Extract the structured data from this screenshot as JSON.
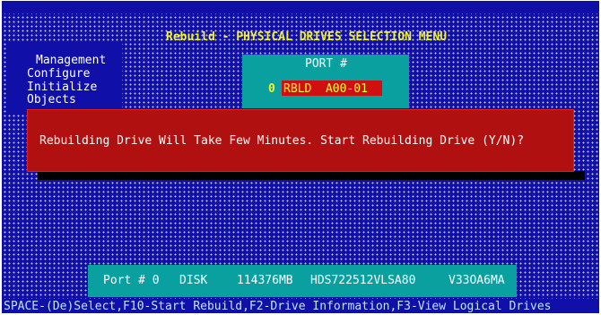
{
  "menu": {
    "title": "Rebuild - PHYSICAL DRIVES SELECTION MENU",
    "items": [
      {
        "label": "Management"
      },
      {
        "label": "Configure"
      },
      {
        "label": "Initialize"
      },
      {
        "label": "Objects"
      }
    ]
  },
  "port_panel": {
    "header": "PORT #",
    "index": "0",
    "drive": "RBLD  A00-01"
  },
  "dialog": {
    "message": "Rebuilding Drive Will Take Few Minutes. Start Rebuilding Drive (Y/N)?"
  },
  "device_info": {
    "port_label": "Port # 0",
    "type": "DISK",
    "size": "114376MB",
    "model": "HDS722512VLSA80",
    "firmware": "V33OA6MA"
  },
  "status_bar": {
    "text": "SPACE-(De)Select,F10-Start Rebuild,F2-Drive Information,F3-View Logical Drives"
  },
  "colors": {
    "background": "#1010a8",
    "panel_cyan": "#0aa0a0",
    "dialog_red": "#b01010",
    "title_yellow": "#f2f22a"
  }
}
